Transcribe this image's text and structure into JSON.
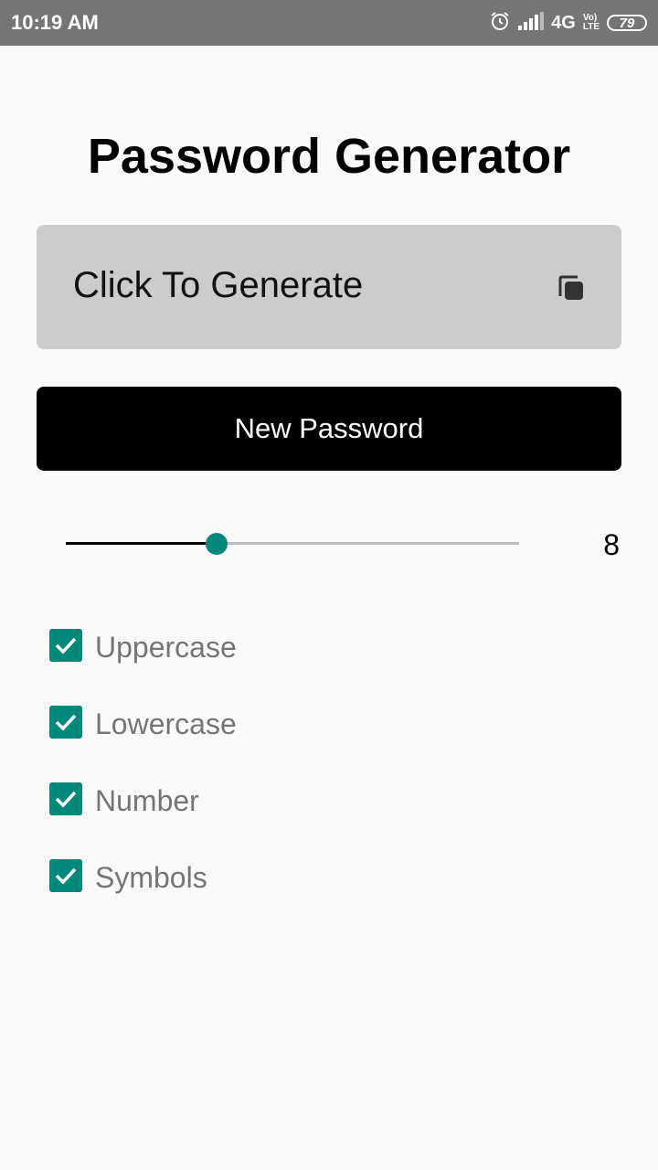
{
  "status_bar": {
    "time": "10:19 AM",
    "network": "4G",
    "volte_top": "Vo)",
    "volte_bottom": "LTE",
    "battery": "79",
    "icons": [
      "alarm-icon",
      "signal-icon"
    ]
  },
  "app": {
    "title": "Password Generator",
    "password_display": "Click To Generate",
    "copy_icon": "copy-icon",
    "new_password_label": "New Password",
    "length": {
      "value": "8",
      "slider_fraction": 0.333
    },
    "options": [
      {
        "label": "Uppercase",
        "checked": true
      },
      {
        "label": "Lowercase",
        "checked": true
      },
      {
        "label": "Number",
        "checked": true
      },
      {
        "label": "Symbols",
        "checked": true
      }
    ]
  },
  "colors": {
    "accent": "#00897b",
    "status_bar": "#757575",
    "password_box": "#cccccc",
    "button": "#000000"
  }
}
